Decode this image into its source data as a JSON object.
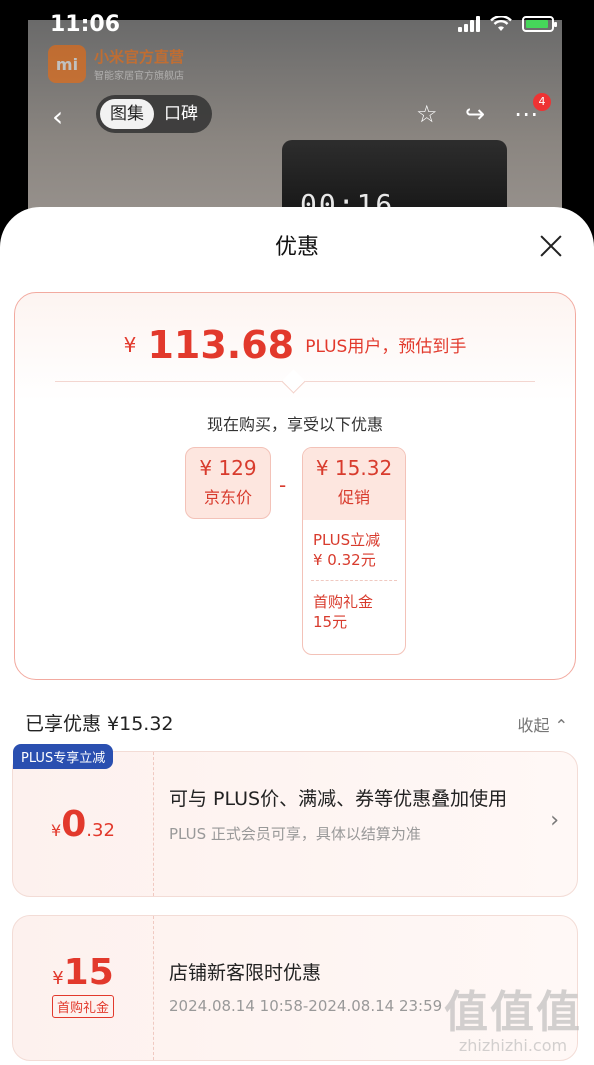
{
  "status_bar": {
    "time": "11:06"
  },
  "store": {
    "logo": "mi",
    "name": "小米官方直营",
    "subtitle": "智能家居官方旗舰店"
  },
  "nav": {
    "tabs": [
      "图集",
      "口碑"
    ],
    "active_tab": "图集",
    "menu_badge": "4"
  },
  "product_display": {
    "digits": "00:16"
  },
  "sheet": {
    "title": "优惠"
  },
  "price_card": {
    "currency": "¥",
    "final_price": "113.68",
    "note": "PLUS用户，预估到手",
    "buy_now_text": "现在购买，享受以下优惠",
    "jd_price_value": "¥ 129",
    "jd_price_label": "京东价",
    "minus": "-",
    "promo_value": "¥ 15.32",
    "promo_label": "促销",
    "promo_items": [
      {
        "line1": "PLUS立减",
        "line2": "¥ 0.32元"
      },
      {
        "line1": "首购礼金",
        "line2": "15元"
      }
    ]
  },
  "enjoyed": {
    "label": "已享优惠 ¥15.32",
    "collapse": "收起"
  },
  "coupons": [
    {
      "tag": "PLUS专享立减",
      "yen": "¥",
      "int": "0",
      "dec": ".32",
      "title": "可与 PLUS价、满减、券等优惠叠加使用",
      "subtitle": "PLUS 正式会员可享，具体以结算为准"
    },
    {
      "yen": "¥",
      "int": "15",
      "tag": "首购礼金",
      "title": "店铺新客限时优惠",
      "subtitle": "2024.08.14 10:58-2024.08.14 23:59"
    }
  ],
  "watermark": {
    "big": "值值值",
    "small": "zhizhizhi.com"
  },
  "colors": {
    "accent": "#e2392c",
    "plus_tag": "#2a4fb0"
  }
}
